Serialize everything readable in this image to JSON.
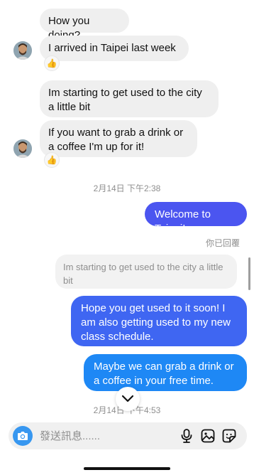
{
  "thread": {
    "incoming": [
      {
        "text": "How you doing?"
      },
      {
        "text": "I arrived in Taipei last week",
        "reaction": "👍"
      },
      {
        "text": "Im starting to get used to the city a little bit"
      },
      {
        "text": "If you want to grab a drink or a coffee I'm up for it!",
        "reaction": "👍"
      }
    ],
    "timestamp_1": "2月14日 下午2:38",
    "outgoing_1": {
      "text": "Welcome to Taipei!"
    },
    "reply_note": "你已回覆",
    "quoted_text": "Im starting to get used to the city a little bit",
    "outgoing_2": {
      "text": "Hope you get used to it soon! I am also getting used to my new class schedule."
    },
    "outgoing_3": {
      "text": "Maybe we can grab a drink or a coffee in your free time."
    },
    "timestamp_2": "2月14日 下午4:53"
  },
  "composer": {
    "placeholder": "發送訊息......"
  },
  "icons": {
    "camera": "camera-icon",
    "microphone": "microphone-icon",
    "gallery": "gallery-icon",
    "sticker": "sticker-icon",
    "scroll_down": "chevron-down-icon"
  },
  "colors": {
    "incoming_bubble": "#efefef",
    "outgoing_top": "#4b55f0",
    "outgoing_bottom": "#1e88f5",
    "camera_button": "#3797f0"
  }
}
